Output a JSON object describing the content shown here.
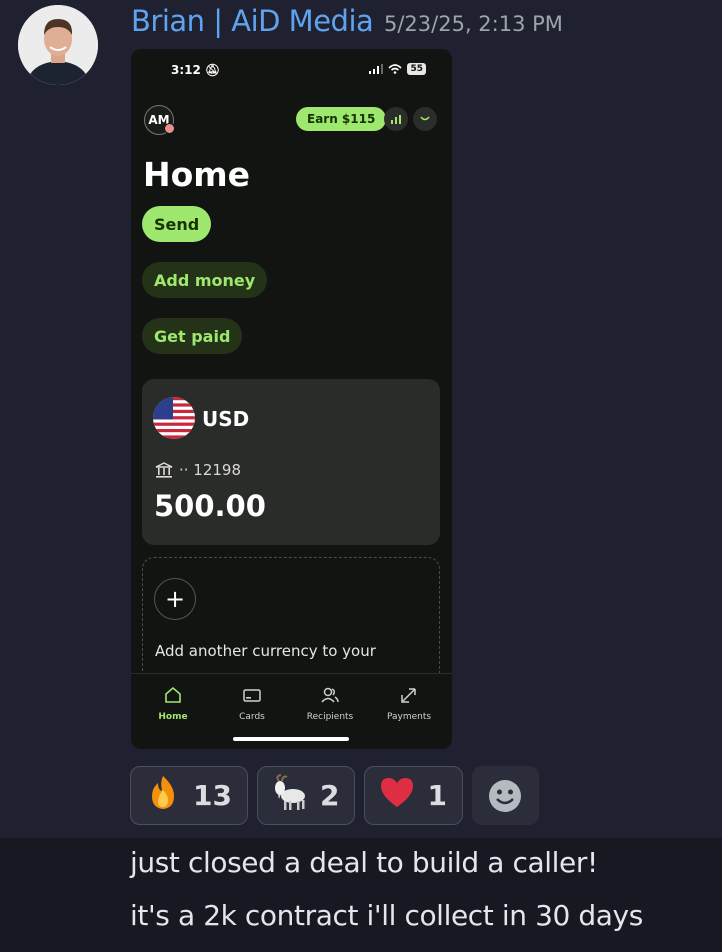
{
  "message": {
    "author": "Brian | AiD Media",
    "timestamp": "5/23/25, 2:13 PM",
    "lines": [
      "just closed a deal to build a caller!",
      "it's a 2k contract i'll collect in 30 days"
    ]
  },
  "phone": {
    "status": {
      "time": "3:12",
      "battery": "55"
    },
    "header": {
      "avatar_initials": "AM",
      "earn_label": "Earn $115"
    },
    "title": "Home",
    "actions": {
      "send": "Send",
      "add_money": "Add money",
      "get_paid": "Get paid"
    },
    "balance_card": {
      "currency": "USD",
      "account": "·· 12198",
      "balance": "500.00"
    },
    "add_currency": {
      "text_line1": "Add another currency to your",
      "text_line2": "..."
    },
    "nav": [
      {
        "label": "Home",
        "icon": "home-icon"
      },
      {
        "label": "Cards",
        "icon": "card-icon"
      },
      {
        "label": "Recipients",
        "icon": "recipients-icon"
      },
      {
        "label": "Payments",
        "icon": "payments-icon"
      }
    ],
    "accent_color": "#9fe870"
  },
  "reactions": [
    {
      "emoji": "🔥",
      "icon": "fire-emoji",
      "count": "13"
    },
    {
      "emoji": "🐐",
      "icon": "goat-emoji",
      "count": "2"
    },
    {
      "emoji": "❤",
      "icon": "heart-emoji",
      "count": "1"
    }
  ]
}
